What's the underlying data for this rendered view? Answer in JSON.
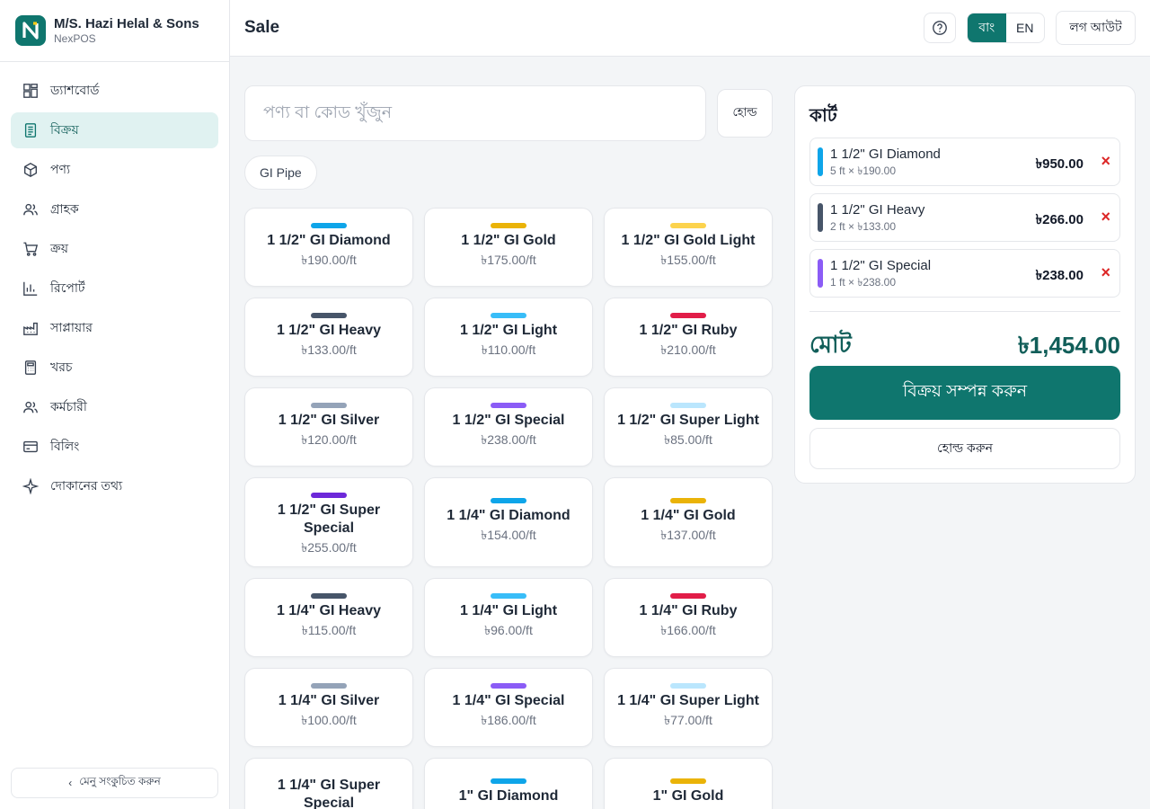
{
  "brand": {
    "name": "M/S. Hazi Helal & Sons",
    "subtitle": "NexPOS"
  },
  "sidebar": {
    "items": [
      {
        "label": "ড্যাশবোর্ড",
        "icon": "dashboard-icon"
      },
      {
        "label": "বিক্রয়",
        "icon": "receipt-icon",
        "active": true
      },
      {
        "label": "পণ্য",
        "icon": "box-icon"
      },
      {
        "label": "গ্রাহক",
        "icon": "users-icon"
      },
      {
        "label": "ক্রয়",
        "icon": "cart-icon"
      },
      {
        "label": "রিপোর্ট",
        "icon": "bar-chart-icon"
      },
      {
        "label": "সাপ্লায়ার",
        "icon": "factory-icon"
      },
      {
        "label": "খরচ",
        "icon": "calculator-icon"
      },
      {
        "label": "কর্মচারী",
        "icon": "staff-icon"
      },
      {
        "label": "বিলিং",
        "icon": "card-icon"
      },
      {
        "label": "দোকানের তথ্য",
        "icon": "sparkle-icon"
      }
    ],
    "collapse_label": "মেনু সংকুচিত করুন"
  },
  "header": {
    "title": "Sale",
    "lang_bn": "বাং",
    "lang_en": "EN",
    "logout_label": "লগ আউট"
  },
  "search": {
    "placeholder": "পণ্য বা কোড খুঁজুন",
    "value": ""
  },
  "hold_top_label": "হোল্ড",
  "category_chip": "GI Pipe",
  "products": [
    {
      "name": "1 1/2\" GI Diamond",
      "price": "৳190.00/ft",
      "color": "#0ea5e9"
    },
    {
      "name": "1 1/2\" GI Gold",
      "price": "৳175.00/ft",
      "color": "#eab308"
    },
    {
      "name": "1 1/2\" GI Gold Light",
      "price": "৳155.00/ft",
      "color": "#fcd34d"
    },
    {
      "name": "1 1/2\" GI Heavy",
      "price": "৳133.00/ft",
      "color": "#475569"
    },
    {
      "name": "1 1/2\" GI Light",
      "price": "৳110.00/ft",
      "color": "#38bdf8"
    },
    {
      "name": "1 1/2\" GI Ruby",
      "price": "৳210.00/ft",
      "color": "#e11d48"
    },
    {
      "name": "1 1/2\" GI Silver",
      "price": "৳120.00/ft",
      "color": "#94a3b8"
    },
    {
      "name": "1 1/2\" GI Special",
      "price": "৳238.00/ft",
      "color": "#8b5cf6"
    },
    {
      "name": "1 1/2\" GI Super Light",
      "price": "৳85.00/ft",
      "color": "#bae6fd"
    },
    {
      "name": "1 1/2\" GI Super Special",
      "price": "৳255.00/ft",
      "color": "#6d28d9"
    },
    {
      "name": "1 1/4\" GI Diamond",
      "price": "৳154.00/ft",
      "color": "#0ea5e9"
    },
    {
      "name": "1 1/4\" GI Gold",
      "price": "৳137.00/ft",
      "color": "#eab308"
    },
    {
      "name": "1 1/4\" GI Heavy",
      "price": "৳115.00/ft",
      "color": "#475569"
    },
    {
      "name": "1 1/4\" GI Light",
      "price": "৳96.00/ft",
      "color": "#38bdf8"
    },
    {
      "name": "1 1/4\" GI Ruby",
      "price": "৳166.00/ft",
      "color": "#e11d48"
    },
    {
      "name": "1 1/4\" GI Silver",
      "price": "৳100.00/ft",
      "color": "#94a3b8"
    },
    {
      "name": "1 1/4\" GI Special",
      "price": "৳186.00/ft",
      "color": "#8b5cf6"
    },
    {
      "name": "1 1/4\" GI Super Light",
      "price": "৳77.00/ft",
      "color": "#bae6fd"
    },
    {
      "name": "1 1/4\" GI Super Special",
      "price": "",
      "color": "#6d28d9"
    },
    {
      "name": "1\" GI Diamond",
      "price": "",
      "color": "#0ea5e9"
    },
    {
      "name": "1\" GI Gold",
      "price": "",
      "color": "#eab308"
    }
  ],
  "cart": {
    "title": "কার্ট",
    "items": [
      {
        "name": "1 1/2\" GI Diamond",
        "detail": "5 ft × ৳190.00",
        "amount": "৳950.00",
        "color": "#0ea5e9",
        "remove": "×"
      },
      {
        "name": "1 1/2\" GI Heavy",
        "detail": "2 ft × ৳133.00",
        "amount": "৳266.00",
        "color": "#475569",
        "remove": "×"
      },
      {
        "name": "1 1/2\" GI Special",
        "detail": "1 ft × ৳238.00",
        "amount": "৳238.00",
        "color": "#8b5cf6",
        "remove": "×"
      }
    ],
    "total_label": "মোট",
    "total_value": "৳1,454.00",
    "complete_label": "বিক্রয় সম্পন্ন করুন",
    "hold_label": "হোল্ড করুন"
  },
  "colors": {
    "accent": "#0f766e",
    "danger": "#dc2626"
  }
}
